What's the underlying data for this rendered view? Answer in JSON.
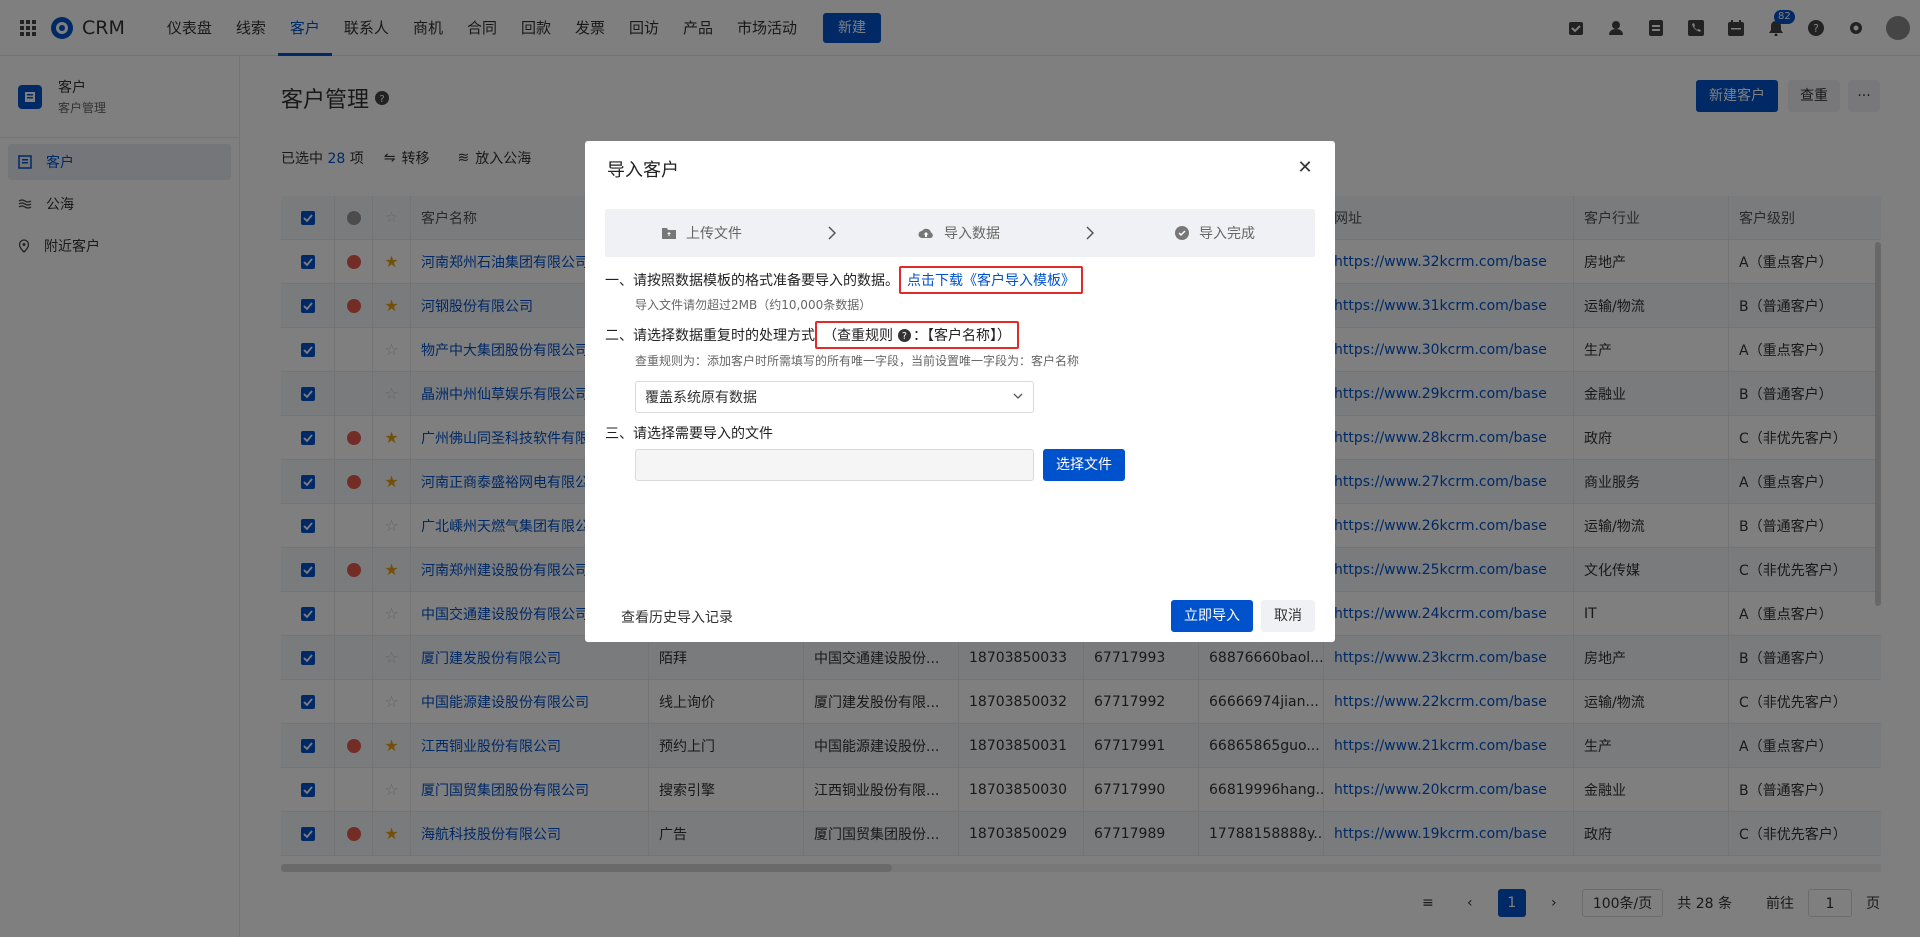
{
  "app": {
    "name": "CRM",
    "brand_color": "#0052cc"
  },
  "nav": {
    "items": [
      "仪表盘",
      "线索",
      "客户",
      "联系人",
      "商机",
      "合同",
      "回款",
      "发票",
      "回访",
      "产品",
      "市场活动"
    ],
    "active": "客户",
    "new_label": "新建"
  },
  "topbar": {
    "notification_count": "82"
  },
  "sidebar": {
    "title": "客户",
    "subtitle": "客户管理",
    "items": [
      {
        "label": "客户",
        "icon": "customer-icon",
        "active": true
      },
      {
        "label": "公海",
        "icon": "sea-icon",
        "active": false
      },
      {
        "label": "附近客户",
        "icon": "location-icon",
        "active": false
      }
    ]
  },
  "page": {
    "title": "客户管理",
    "new_customer_label": "新建客户",
    "dedup_label": "查重",
    "more_label": "···"
  },
  "selection": {
    "prefix": "已选中",
    "count": "28",
    "suffix": "项",
    "actions": [
      {
        "label": "转移",
        "icon": "transfer-icon"
      },
      {
        "label": "放入公海",
        "icon": "sea-icon"
      }
    ]
  },
  "table": {
    "columns": [
      "客户名称",
      "",
      "",
      "",
      "",
      "",
      "网址",
      "客户行业",
      "客户级别"
    ],
    "rows": [
      {
        "name": "河南郑州石油集团有限公司",
        "source": "",
        "contact": "",
        "phone": "",
        "tel": "",
        "email": "",
        "url": "https://www.32kcrm.com/base",
        "industry": "房地产",
        "level": "A（重点客户）",
        "info": true,
        "star": true
      },
      {
        "name": "河钢股份有限公司",
        "source": "",
        "contact": "",
        "phone": "",
        "tel": "",
        "email": "",
        "url": "https://www.31kcrm.com/base",
        "industry": "运输/物流",
        "level": "B（普通客户）",
        "info": true,
        "star": true
      },
      {
        "name": "物产中大集团股份有限公司",
        "source": "",
        "contact": "",
        "phone": "",
        "tel": "",
        "email": "",
        "url": "https://www.30kcrm.com/base",
        "industry": "生产",
        "level": "A（重点客户）",
        "info": false,
        "star": false
      },
      {
        "name": "晶洲中州仙草娱乐有限公司",
        "source": "",
        "contact": "",
        "phone": "",
        "tel": "",
        "email": "",
        "url": "https://www.29kcrm.com/base",
        "industry": "金融业",
        "level": "B（普通客户）",
        "info": false,
        "star": false
      },
      {
        "name": "广州佛山同圣科技软件有限公司",
        "source": "",
        "contact": "",
        "phone": "",
        "tel": "",
        "email": "",
        "url": "https://www.28kcrm.com/base",
        "industry": "政府",
        "level": "C（非优先客户）",
        "info": true,
        "star": true
      },
      {
        "name": "河南正商泰盛裕网电有限公司",
        "source": "",
        "contact": "",
        "phone": "",
        "tel": "",
        "email": "",
        "url": "https://www.27kcrm.com/base",
        "industry": "商业服务",
        "level": "A（重点客户）",
        "info": true,
        "star": true
      },
      {
        "name": "广北嵊州天燃气集团有限公司",
        "source": "",
        "contact": "",
        "phone": "",
        "tel": "",
        "email": "",
        "url": "https://www.26kcrm.com/base",
        "industry": "运输/物流",
        "level": "B（普通客户）",
        "info": false,
        "star": false
      },
      {
        "name": "河南郑州建设股份有限公司",
        "source": "",
        "contact": "",
        "phone": "",
        "tel": "",
        "email": "",
        "url": "https://www.25kcrm.com/base",
        "industry": "文化传媒",
        "level": "C（非优先客户）",
        "info": true,
        "star": true
      },
      {
        "name": "中国交通建设股份有限公司",
        "source": "",
        "contact": "",
        "phone": "",
        "tel": "",
        "email": "",
        "url": "https://www.24kcrm.com/base",
        "industry": "IT",
        "level": "A（重点客户）",
        "info": false,
        "star": false
      },
      {
        "name": "厦门建发股份有限公司",
        "source": "陌拜",
        "contact": "中国交通建设股份...",
        "phone": "18703850033",
        "tel": "67717993",
        "email": "68876660baol...",
        "url": "https://www.23kcrm.com/base",
        "industry": "房地产",
        "level": "B（普通客户）",
        "info": false,
        "star": false
      },
      {
        "name": "中国能源建设股份有限公司",
        "source": "线上询价",
        "contact": "厦门建发股份有限...",
        "phone": "18703850032",
        "tel": "67717992",
        "email": "66666974jian...",
        "url": "https://www.22kcrm.com/base",
        "industry": "运输/物流",
        "level": "C（非优先客户）",
        "info": false,
        "star": false
      },
      {
        "name": "江西铜业股份有限公司",
        "source": "预约上门",
        "contact": "中国能源建设股份...",
        "phone": "18703850031",
        "tel": "67717991",
        "email": "66865865guo...",
        "url": "https://www.21kcrm.com/base",
        "industry": "生产",
        "level": "A（重点客户）",
        "info": true,
        "star": true
      },
      {
        "name": "厦门国贸集团股份有限公司",
        "source": "搜索引擎",
        "contact": "江西铜业股份有限...",
        "phone": "18703850030",
        "tel": "67717990",
        "email": "66819996hang...",
        "url": "https://www.20kcrm.com/base",
        "industry": "金融业",
        "level": "B（普通客户）",
        "info": false,
        "star": false
      },
      {
        "name": "海航科技股份有限公司",
        "source": "广告",
        "contact": "厦门国贸集团股份...",
        "phone": "18703850029",
        "tel": "67717989",
        "email": "17788158888y...",
        "url": "https://www.19kcrm.com/base",
        "industry": "政府",
        "level": "C（非优先客户）",
        "info": true,
        "star": true
      }
    ]
  },
  "pagination": {
    "current": "1",
    "page_size": "100条/页",
    "total": "共 28 条",
    "goto_label": "前往",
    "goto_value": "1",
    "page_suffix": "页"
  },
  "modal": {
    "title": "导入客户",
    "steps": [
      {
        "label": "上传文件",
        "icon": "folder-upload-icon"
      },
      {
        "label": "导入数据",
        "icon": "cloud-upload-icon"
      },
      {
        "label": "导入完成",
        "icon": "check-circle-icon"
      }
    ],
    "sec1": "一、请按照数据模板的格式准备要导入的数据。",
    "sec1_link": "点击下载《客户导入模板》",
    "sec1_note": "导入文件请勿超过2MB（约10,000条数据）",
    "sec2": "二、请选择数据重复时的处理方式",
    "sec2_rule_prefix": "（查重规则",
    "sec2_rule_suffix": "：【客户名称】）",
    "sec2_note": "查重规则为：添加客户时所需填写的所有唯一字段，当前设置唯一字段为：客户名称",
    "dup_option": "覆盖系统原有数据",
    "sec3": "三、请选择需要导入的文件",
    "choose_file": "选择文件",
    "history": "查看历史导入记录",
    "import_now": "立即导入",
    "cancel": "取消"
  }
}
